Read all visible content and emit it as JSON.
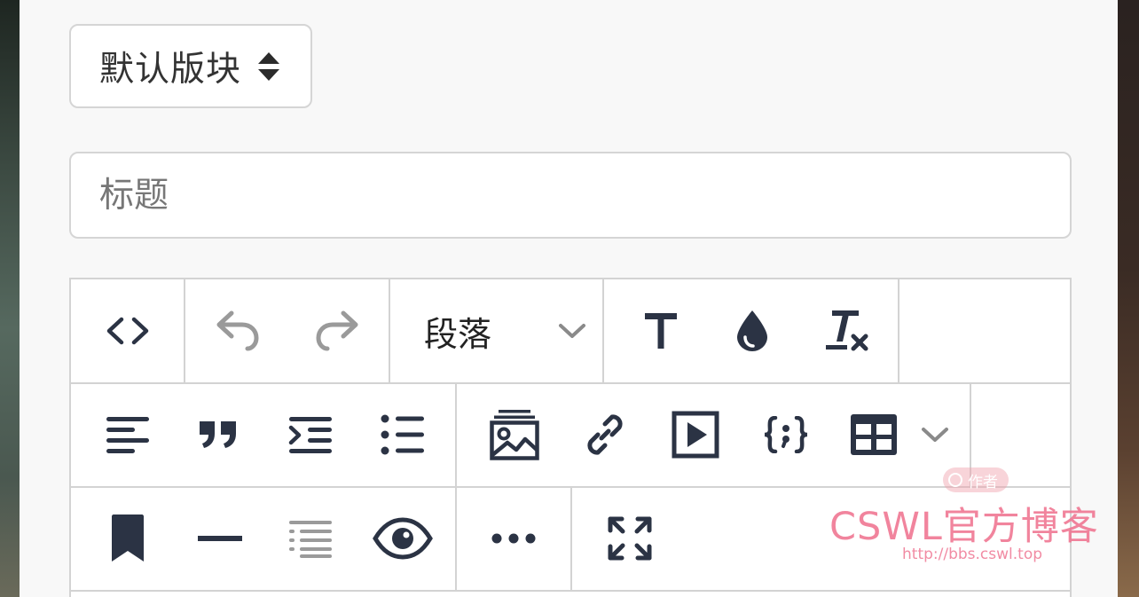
{
  "block_select": {
    "label": "默认版块",
    "icon": "sort-arrows-icon"
  },
  "title_input": {
    "placeholder": "标题",
    "value": ""
  },
  "toolbar": {
    "row1": [
      {
        "name": "source-code-button",
        "icon": "code-icon"
      },
      {
        "name": "undo-button",
        "icon": "undo-icon",
        "disabled": true
      },
      {
        "name": "redo-button",
        "icon": "redo-icon",
        "disabled": true
      },
      {
        "name": "paragraph-dropdown",
        "label": "段落",
        "icon": "chevron-down-icon"
      },
      {
        "name": "font-size-button",
        "icon": "text-icon"
      },
      {
        "name": "text-color-button",
        "icon": "color-drop-icon"
      },
      {
        "name": "clear-format-button",
        "icon": "clear-format-icon"
      }
    ],
    "row2": [
      {
        "name": "align-button",
        "icon": "align-left-icon"
      },
      {
        "name": "blockquote-button",
        "icon": "quote-icon"
      },
      {
        "name": "indent-button",
        "icon": "indent-icon"
      },
      {
        "name": "bullet-list-button",
        "icon": "list-icon"
      },
      {
        "name": "insert-image-button",
        "icon": "image-icon"
      },
      {
        "name": "insert-link-button",
        "icon": "link-icon"
      },
      {
        "name": "insert-video-button",
        "icon": "video-icon"
      },
      {
        "name": "insert-code-button",
        "icon": "braces-icon"
      },
      {
        "name": "insert-table-button",
        "icon": "table-icon"
      },
      {
        "name": "table-dropdown-button",
        "icon": "chevron-down-icon"
      }
    ],
    "row3": [
      {
        "name": "bookmark-button",
        "icon": "bookmark-icon"
      },
      {
        "name": "horizontal-rule-button",
        "icon": "minus-icon"
      },
      {
        "name": "toc-button",
        "icon": "toc-list-icon",
        "disabled": true
      },
      {
        "name": "preview-button",
        "icon": "eye-icon"
      },
      {
        "name": "more-button",
        "icon": "ellipsis-icon"
      },
      {
        "name": "fullscreen-button",
        "icon": "expand-icon"
      }
    ]
  },
  "colors": {
    "icon_dark": "#2b3344",
    "icon_disabled": "#9a9a9a",
    "border": "#d3d3d3",
    "panel_bg": "#f8f8f8",
    "watermark": "#ee6e8c"
  },
  "watermark": {
    "badge": "作者",
    "main": "CSWL官方博客",
    "url": "http://bbs.cswl.top"
  }
}
